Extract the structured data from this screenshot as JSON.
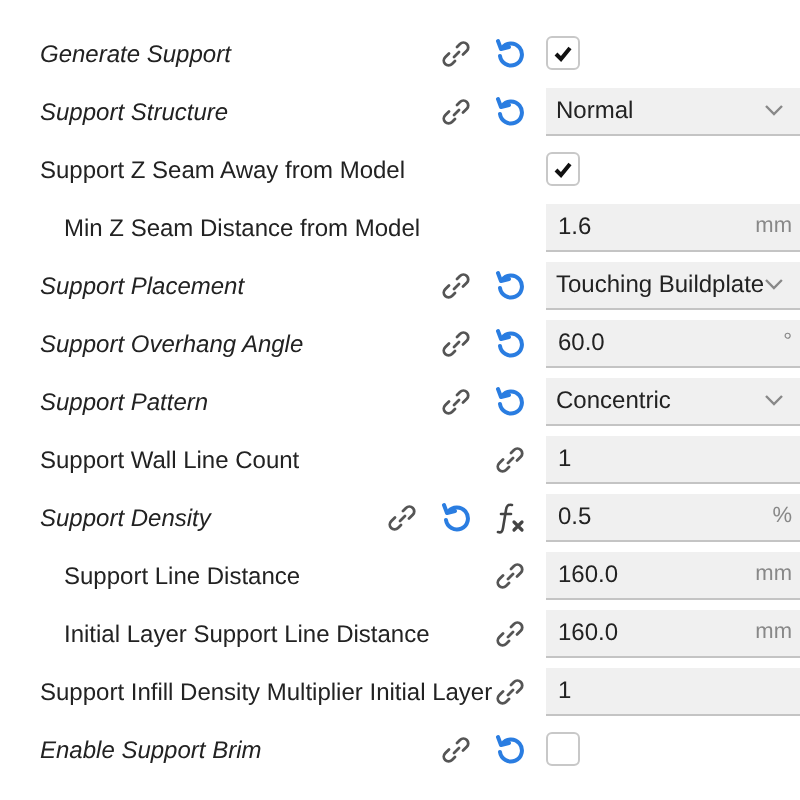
{
  "settings": [
    {
      "label": "Generate Support",
      "modified": true,
      "linked": true,
      "resettable": true,
      "formula": false,
      "control": {
        "kind": "checkbox",
        "checked": true
      }
    },
    {
      "label": "Support Structure",
      "modified": true,
      "linked": true,
      "resettable": true,
      "formula": false,
      "control": {
        "kind": "dropdown",
        "value": "Normal"
      }
    },
    {
      "label": "Support Z Seam Away from Model",
      "modified": false,
      "linked": false,
      "resettable": false,
      "formula": false,
      "control": {
        "kind": "checkbox",
        "checked": true
      },
      "children": [
        {
          "label": "Min Z Seam Distance from Model",
          "modified": false,
          "linked": false,
          "resettable": false,
          "formula": false,
          "control": {
            "kind": "number",
            "value": "1.6",
            "unit": "mm"
          }
        }
      ]
    },
    {
      "label": "Support Placement",
      "modified": true,
      "linked": true,
      "resettable": true,
      "formula": false,
      "control": {
        "kind": "dropdown",
        "value": "Touching Buildplate"
      }
    },
    {
      "label": "Support Overhang Angle",
      "modified": true,
      "linked": true,
      "resettable": true,
      "formula": false,
      "control": {
        "kind": "number",
        "value": "60.0",
        "unit": "°"
      }
    },
    {
      "label": "Support Pattern",
      "modified": true,
      "linked": true,
      "resettable": true,
      "formula": false,
      "control": {
        "kind": "dropdown",
        "value": "Concentric"
      }
    },
    {
      "label": "Support Wall Line Count",
      "modified": false,
      "linked": true,
      "resettable": false,
      "formula": false,
      "control": {
        "kind": "number",
        "value": "1"
      }
    },
    {
      "label": "Support Density",
      "modified": true,
      "linked": true,
      "resettable": true,
      "formula": true,
      "control": {
        "kind": "number",
        "value": "0.5",
        "unit": "%"
      },
      "children": [
        {
          "label": "Support Line Distance",
          "modified": false,
          "linked": true,
          "resettable": false,
          "formula": false,
          "control": {
            "kind": "number",
            "value": "160.0",
            "unit": "mm"
          }
        },
        {
          "label": "Initial Layer Support Line Distance",
          "modified": false,
          "linked": true,
          "resettable": false,
          "formula": false,
          "control": {
            "kind": "number",
            "value": "160.0",
            "unit": "mm"
          }
        }
      ]
    },
    {
      "label": "Support Infill Density Multiplier Initial Layer",
      "modified": false,
      "linked": true,
      "resettable": false,
      "formula": false,
      "control": {
        "kind": "number",
        "value": "1"
      }
    },
    {
      "label": "Enable Support Brim",
      "modified": true,
      "linked": true,
      "resettable": true,
      "formula": false,
      "control": {
        "kind": "checkbox",
        "checked": false
      }
    }
  ]
}
